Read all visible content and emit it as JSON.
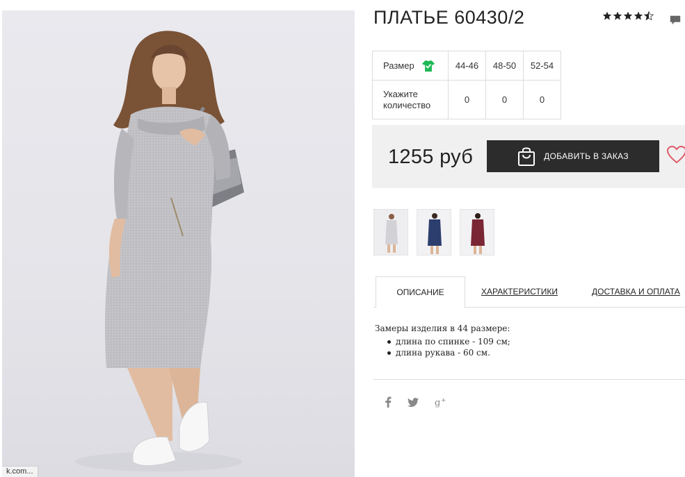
{
  "product": {
    "title": "ПЛАТЬЕ 60430/2",
    "rating": 4.5,
    "price": "1255 руб"
  },
  "size_table": {
    "size_label": "Размер",
    "sizes": [
      "44-46",
      "48-50",
      "52-54"
    ],
    "quantity_label": "Укажите количество",
    "quantities": [
      "0",
      "0",
      "0"
    ]
  },
  "actions": {
    "order_label": "ДОБАВИТЬ В ЗАКАЗ"
  },
  "thumbnails": [
    {
      "color": "#d8d8dc",
      "alt": "grey"
    },
    {
      "color": "#2c3e6e",
      "alt": "navy"
    },
    {
      "color": "#7a2634",
      "alt": "burgundy"
    }
  ],
  "tabs": [
    {
      "label": "ОПИСАНИЕ",
      "active": true
    },
    {
      "label": "ХАРАКТЕРИСТИКИ",
      "active": false
    },
    {
      "label": "ДОСТАВКА И ОПЛАТА",
      "active": false
    }
  ],
  "description": {
    "intro": "Замеры изделия в 44 размере:",
    "items": [
      "длина по спинке - 109 см;",
      "длина рукава - 60 см."
    ]
  },
  "social": [
    "facebook-icon",
    "twitter-icon",
    "google-plus-icon"
  ],
  "statusbar": {
    "text": "k.com..."
  },
  "colors": {
    "button_bg": "#2c2c2c",
    "price_bar_bg": "#f0f0f0",
    "check_green": "#1db954",
    "heart": "#e05a6a"
  }
}
